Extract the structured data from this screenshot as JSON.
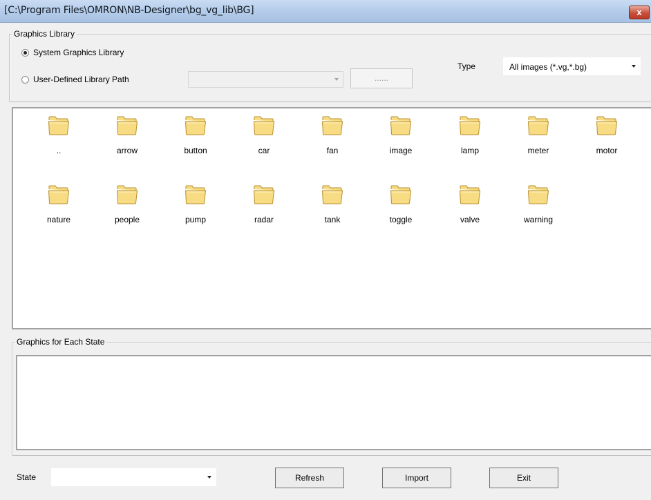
{
  "window": {
    "title": "[C:\\Program Files\\OMRON\\NB-Designer\\bg_vg_lib\\BG]",
    "close_glyph": "x"
  },
  "graphics_library": {
    "legend": "Graphics Library",
    "system_option": "System Graphics Library",
    "user_option": "User-Defined Library Path",
    "selected": "system",
    "path_value": "",
    "browse_label": "......",
    "type_label": "Type",
    "type_value": "All images (*.vg,*.bg)"
  },
  "folders": [
    {
      "label": "..",
      "icon": "folder-icon"
    },
    {
      "label": "arrow",
      "icon": "folder-icon"
    },
    {
      "label": "button",
      "icon": "folder-icon"
    },
    {
      "label": "car",
      "icon": "folder-icon"
    },
    {
      "label": "fan",
      "icon": "folder-icon"
    },
    {
      "label": "image",
      "icon": "folder-icon"
    },
    {
      "label": "lamp",
      "icon": "folder-icon"
    },
    {
      "label": "meter",
      "icon": "folder-icon"
    },
    {
      "label": "motor",
      "icon": "folder-icon"
    },
    {
      "label": "nature",
      "icon": "folder-icon"
    },
    {
      "label": "people",
      "icon": "folder-icon"
    },
    {
      "label": "pump",
      "icon": "folder-icon"
    },
    {
      "label": "radar",
      "icon": "folder-icon"
    },
    {
      "label": "tank",
      "icon": "folder-icon"
    },
    {
      "label": "toggle",
      "icon": "folder-icon"
    },
    {
      "label": "valve",
      "icon": "folder-icon"
    },
    {
      "label": "warning",
      "icon": "folder-icon"
    }
  ],
  "state_group": {
    "legend": "Graphics for Each State"
  },
  "footer": {
    "state_label": "State",
    "state_value": "",
    "refresh_label": "Refresh",
    "import_label": "Import",
    "exit_label": "Exit"
  },
  "colors": {
    "folder_fill": "#f7dc84",
    "folder_stroke": "#b98f2a",
    "titlebar": "#b6cdea"
  }
}
